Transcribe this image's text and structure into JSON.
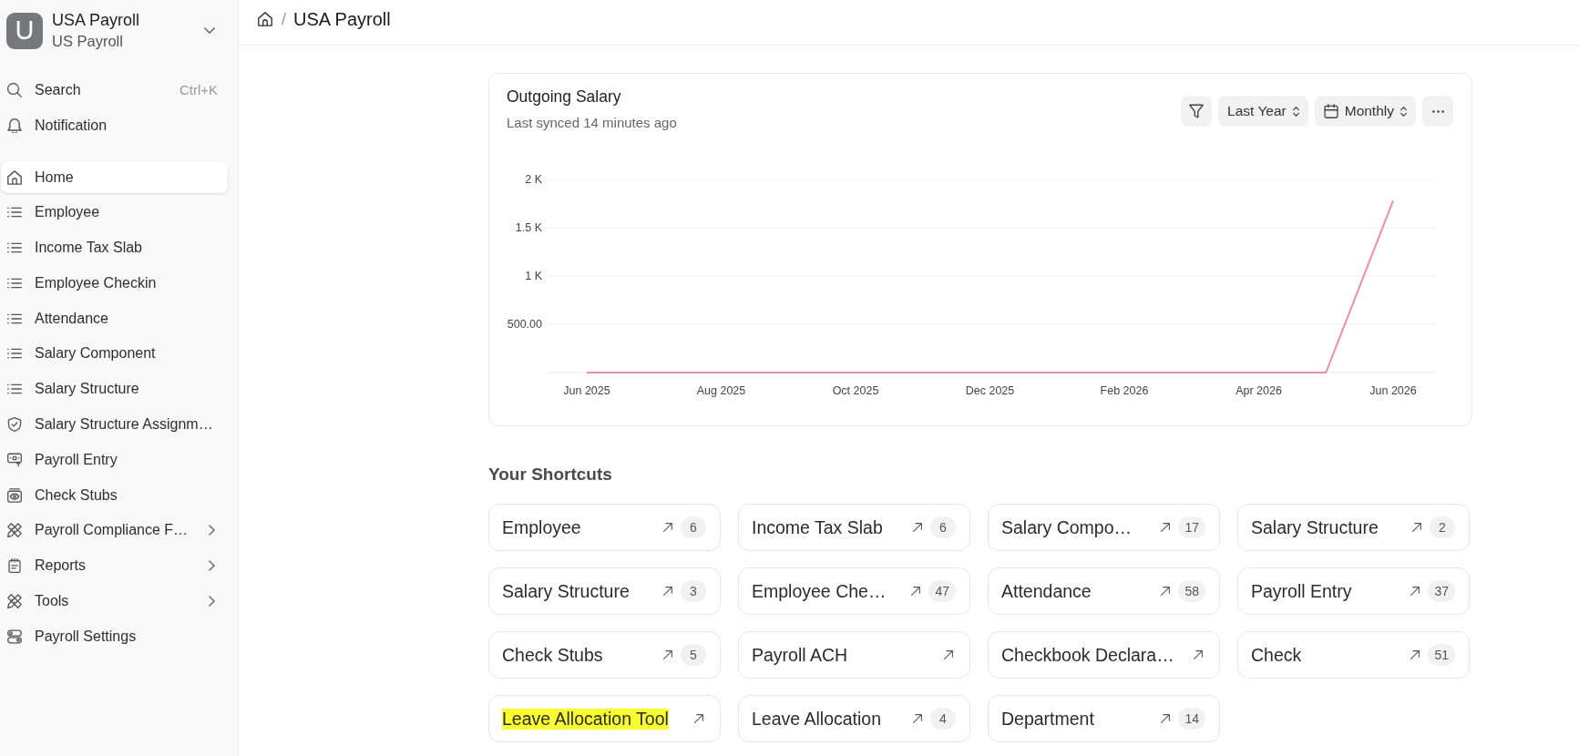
{
  "sidebar": {
    "workspace": {
      "initial": "U",
      "title": "USA Payroll",
      "subtitle": "US Payroll"
    },
    "utilities": [
      {
        "kind": "search",
        "label": "Search",
        "shortcut": "Ctrl+K"
      },
      {
        "kind": "notification",
        "label": "Notification"
      }
    ],
    "items": [
      {
        "kind": "home",
        "label": "Home",
        "selected": true
      },
      {
        "kind": "doctype",
        "label": "Employee",
        "selected": false
      },
      {
        "kind": "doctype",
        "label": "Income Tax Slab",
        "selected": false
      },
      {
        "kind": "doctype",
        "label": "Employee Checkin",
        "selected": false
      },
      {
        "kind": "doctype",
        "label": "Attendance",
        "selected": false
      },
      {
        "kind": "doctype",
        "label": "Salary Component",
        "selected": false
      },
      {
        "kind": "doctype",
        "label": "Salary Structure",
        "selected": false
      },
      {
        "kind": "assignment",
        "label": "Salary Structure Assignm…",
        "selected": false
      },
      {
        "kind": "entry",
        "label": "Payroll Entry",
        "selected": false
      },
      {
        "kind": "stubs",
        "label": "Check Stubs",
        "selected": false
      },
      {
        "kind": "compliance",
        "label": "Payroll Compliance F…",
        "selected": false,
        "expanded": false
      },
      {
        "kind": "reports",
        "label": "Reports",
        "selected": false,
        "expanded": false
      },
      {
        "kind": "tools",
        "label": "Tools",
        "selected": false,
        "expanded": false
      },
      {
        "kind": "settings",
        "label": "Payroll Settings",
        "selected": false
      }
    ]
  },
  "breadcrumb": {
    "separator": "/",
    "current": "USA Payroll"
  },
  "chart_card": {
    "title": "Outgoing Salary",
    "subtitle": "Last synced 14 minutes ago",
    "controls": [
      {
        "kind": "range",
        "label": "Last Year"
      },
      {
        "kind": "interval",
        "label": "Monthly"
      }
    ],
    "chart_data": {
      "type": "line",
      "categories": [
        "Jun 2025",
        null,
        "Aug 2025",
        null,
        "Oct 2025",
        null,
        "Dec 2025",
        null,
        "Feb 2026",
        null,
        "Apr 2026",
        null,
        "Jun 2026"
      ],
      "series": [
        {
          "color": "#ee8aac",
          "values": [
            0,
            0,
            0,
            0,
            0,
            0,
            0,
            0,
            0,
            0,
            0,
            0,
            1780
          ]
        }
      ],
      "ylim": [
        0,
        2000
      ],
      "yticks": [
        {
          "value": 500,
          "label": "500.00"
        },
        {
          "value": 1000,
          "label": "1 K"
        },
        {
          "value": 1500,
          "label": "1.5 K"
        },
        {
          "value": 2000,
          "label": "2 K"
        }
      ],
      "grid": true
    }
  },
  "shortcuts": {
    "title": "Your Shortcuts",
    "items": [
      {
        "label": "Employee",
        "count": "6",
        "highlighted": false
      },
      {
        "label": "Income Tax Slab",
        "count": "6",
        "highlighted": false
      },
      {
        "label": "Salary Compo…",
        "count": "17",
        "highlighted": false
      },
      {
        "label": "Salary Structure",
        "count": "2",
        "highlighted": false
      },
      {
        "label": "Salary Structure",
        "count": "3",
        "highlighted": false
      },
      {
        "label": "Employee Che…",
        "count": "47",
        "highlighted": false
      },
      {
        "label": "Attendance",
        "count": "58",
        "highlighted": false
      },
      {
        "label": "Payroll Entry",
        "count": "37",
        "highlighted": false
      },
      {
        "label": "Check Stubs",
        "count": "5",
        "highlighted": false
      },
      {
        "label": "Payroll ACH",
        "highlighted": false
      },
      {
        "label": "Checkbook Declara…",
        "highlighted": false
      },
      {
        "label": "Check",
        "count": "51",
        "highlighted": false
      },
      {
        "label": "Leave Allocation Tool",
        "highlighted": true
      },
      {
        "label": "Leave Allocation",
        "count": "4",
        "highlighted": false
      },
      {
        "label": "Department",
        "count": "14",
        "highlighted": false
      }
    ]
  }
}
